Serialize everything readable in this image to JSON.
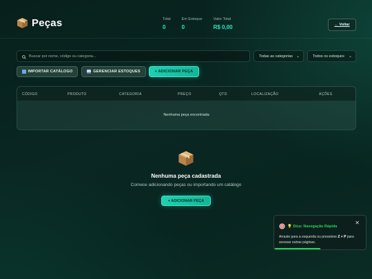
{
  "header": {
    "title": "Peças",
    "back_label": "← Voltar",
    "stats": [
      {
        "label": "Total",
        "value": "0"
      },
      {
        "label": "Em Estoque",
        "value": "0"
      },
      {
        "label": "Valor Total",
        "value": "R$ 0,00"
      }
    ]
  },
  "filters": {
    "search_placeholder": "Buscar por nome, código ou categoria...",
    "category_selected": "Todas as categorias",
    "stock_selected": "Todos os estoques"
  },
  "actions": {
    "import_label": "IMPORTAR CATÁLOGO",
    "manage_label": "GERENCIAR ESTOQUES",
    "add_label": "+ ADICIONAR PEÇA"
  },
  "table": {
    "columns": [
      "CÓDIGO",
      "PRODUTO",
      "CATEGORIA",
      "PREÇO",
      "QTD",
      "LOCALIZAÇÃO",
      "AÇÕES"
    ],
    "empty_text": "Nenhuma peça encontrada"
  },
  "empty_state": {
    "title": "Nenhuma peça cadastrada",
    "subtitle": "Comece adicionando peças ou importando um catálogo",
    "button_label": "+ ADICIONAR PEÇA"
  },
  "toast": {
    "title": "💡 Dica: Navegação Rápida",
    "body_prefix": "Arraste para a esquerda ou pressione ",
    "shortcut": "Z + P",
    "body_suffix": " para acessar outras páginas.",
    "close": "✕",
    "progress": 0.5
  },
  "colors": {
    "accent": "#1fd0b1",
    "stat_value": "#2ee6bf",
    "tip_green": "#22d65a"
  }
}
